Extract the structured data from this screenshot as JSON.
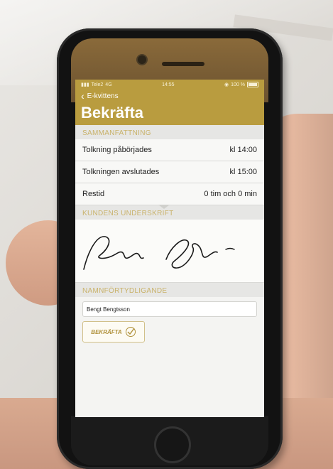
{
  "status_bar": {
    "carrier": "Tele2",
    "network": "4G",
    "time": "14:55",
    "battery": "100 %"
  },
  "nav": {
    "back_label": "E-kvittens",
    "title": "Bekräfta"
  },
  "summary": {
    "header": "SAMMANFATTNING",
    "rows": [
      {
        "label": "Tolkning påbörjades",
        "value": "kl 14:00"
      },
      {
        "label": "Tolkningen avslutades",
        "value": "kl 15:00"
      },
      {
        "label": "Restid",
        "value": "0 tim och 0 min"
      }
    ]
  },
  "signature": {
    "header": "KUNDENS UNDERSKRIFT"
  },
  "name_clarification": {
    "header": "NAMNFÖRTYDLIGANDE",
    "value": "Bengt Bengtsson"
  },
  "confirm_button": {
    "label": "BEKRÄFTA"
  },
  "colors": {
    "accent": "#b99c3f",
    "section_text": "#c9b26a"
  }
}
